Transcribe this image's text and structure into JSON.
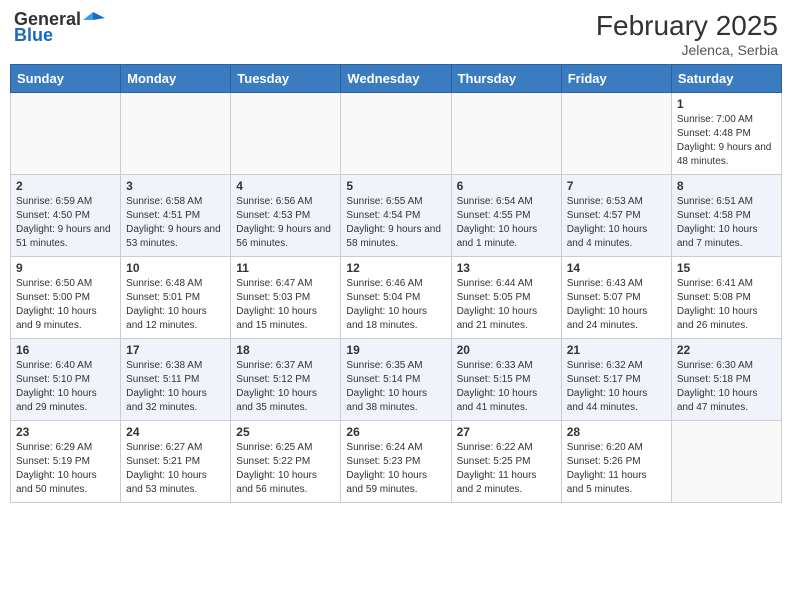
{
  "header": {
    "logo_general": "General",
    "logo_blue": "Blue",
    "month_year": "February 2025",
    "location": "Jelenca, Serbia"
  },
  "weekdays": [
    "Sunday",
    "Monday",
    "Tuesday",
    "Wednesday",
    "Thursday",
    "Friday",
    "Saturday"
  ],
  "weeks": [
    [
      {
        "day": "",
        "info": ""
      },
      {
        "day": "",
        "info": ""
      },
      {
        "day": "",
        "info": ""
      },
      {
        "day": "",
        "info": ""
      },
      {
        "day": "",
        "info": ""
      },
      {
        "day": "",
        "info": ""
      },
      {
        "day": "1",
        "info": "Sunrise: 7:00 AM\nSunset: 4:48 PM\nDaylight: 9 hours and 48 minutes."
      }
    ],
    [
      {
        "day": "2",
        "info": "Sunrise: 6:59 AM\nSunset: 4:50 PM\nDaylight: 9 hours and 51 minutes."
      },
      {
        "day": "3",
        "info": "Sunrise: 6:58 AM\nSunset: 4:51 PM\nDaylight: 9 hours and 53 minutes."
      },
      {
        "day": "4",
        "info": "Sunrise: 6:56 AM\nSunset: 4:53 PM\nDaylight: 9 hours and 56 minutes."
      },
      {
        "day": "5",
        "info": "Sunrise: 6:55 AM\nSunset: 4:54 PM\nDaylight: 9 hours and 58 minutes."
      },
      {
        "day": "6",
        "info": "Sunrise: 6:54 AM\nSunset: 4:55 PM\nDaylight: 10 hours and 1 minute."
      },
      {
        "day": "7",
        "info": "Sunrise: 6:53 AM\nSunset: 4:57 PM\nDaylight: 10 hours and 4 minutes."
      },
      {
        "day": "8",
        "info": "Sunrise: 6:51 AM\nSunset: 4:58 PM\nDaylight: 10 hours and 7 minutes."
      }
    ],
    [
      {
        "day": "9",
        "info": "Sunrise: 6:50 AM\nSunset: 5:00 PM\nDaylight: 10 hours and 9 minutes."
      },
      {
        "day": "10",
        "info": "Sunrise: 6:48 AM\nSunset: 5:01 PM\nDaylight: 10 hours and 12 minutes."
      },
      {
        "day": "11",
        "info": "Sunrise: 6:47 AM\nSunset: 5:03 PM\nDaylight: 10 hours and 15 minutes."
      },
      {
        "day": "12",
        "info": "Sunrise: 6:46 AM\nSunset: 5:04 PM\nDaylight: 10 hours and 18 minutes."
      },
      {
        "day": "13",
        "info": "Sunrise: 6:44 AM\nSunset: 5:05 PM\nDaylight: 10 hours and 21 minutes."
      },
      {
        "day": "14",
        "info": "Sunrise: 6:43 AM\nSunset: 5:07 PM\nDaylight: 10 hours and 24 minutes."
      },
      {
        "day": "15",
        "info": "Sunrise: 6:41 AM\nSunset: 5:08 PM\nDaylight: 10 hours and 26 minutes."
      }
    ],
    [
      {
        "day": "16",
        "info": "Sunrise: 6:40 AM\nSunset: 5:10 PM\nDaylight: 10 hours and 29 minutes."
      },
      {
        "day": "17",
        "info": "Sunrise: 6:38 AM\nSunset: 5:11 PM\nDaylight: 10 hours and 32 minutes."
      },
      {
        "day": "18",
        "info": "Sunrise: 6:37 AM\nSunset: 5:12 PM\nDaylight: 10 hours and 35 minutes."
      },
      {
        "day": "19",
        "info": "Sunrise: 6:35 AM\nSunset: 5:14 PM\nDaylight: 10 hours and 38 minutes."
      },
      {
        "day": "20",
        "info": "Sunrise: 6:33 AM\nSunset: 5:15 PM\nDaylight: 10 hours and 41 minutes."
      },
      {
        "day": "21",
        "info": "Sunrise: 6:32 AM\nSunset: 5:17 PM\nDaylight: 10 hours and 44 minutes."
      },
      {
        "day": "22",
        "info": "Sunrise: 6:30 AM\nSunset: 5:18 PM\nDaylight: 10 hours and 47 minutes."
      }
    ],
    [
      {
        "day": "23",
        "info": "Sunrise: 6:29 AM\nSunset: 5:19 PM\nDaylight: 10 hours and 50 minutes."
      },
      {
        "day": "24",
        "info": "Sunrise: 6:27 AM\nSunset: 5:21 PM\nDaylight: 10 hours and 53 minutes."
      },
      {
        "day": "25",
        "info": "Sunrise: 6:25 AM\nSunset: 5:22 PM\nDaylight: 10 hours and 56 minutes."
      },
      {
        "day": "26",
        "info": "Sunrise: 6:24 AM\nSunset: 5:23 PM\nDaylight: 10 hours and 59 minutes."
      },
      {
        "day": "27",
        "info": "Sunrise: 6:22 AM\nSunset: 5:25 PM\nDaylight: 11 hours and 2 minutes."
      },
      {
        "day": "28",
        "info": "Sunrise: 6:20 AM\nSunset: 5:26 PM\nDaylight: 11 hours and 5 minutes."
      },
      {
        "day": "",
        "info": ""
      }
    ]
  ]
}
